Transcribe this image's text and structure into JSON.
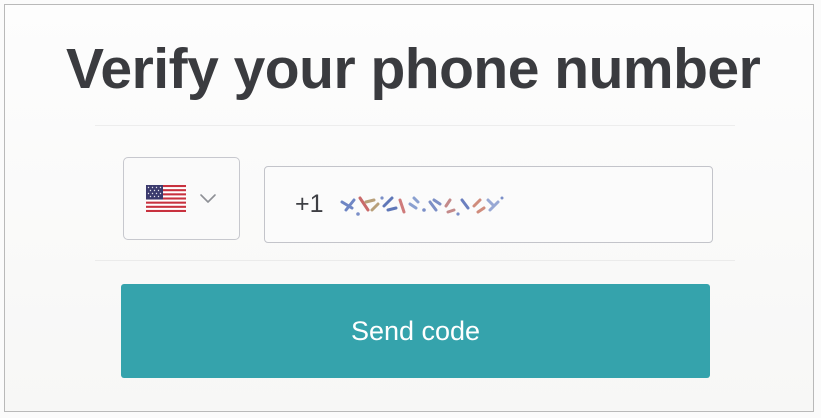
{
  "dialog": {
    "title": "Verify your phone number"
  },
  "country_select": {
    "flag_icon": "us-flag-icon",
    "chevron_icon": "chevron-down-icon"
  },
  "phone_input": {
    "dial_code": "+1",
    "number_redacted": true
  },
  "send_button": {
    "label": "Send code",
    "color": "#35a3ac"
  }
}
